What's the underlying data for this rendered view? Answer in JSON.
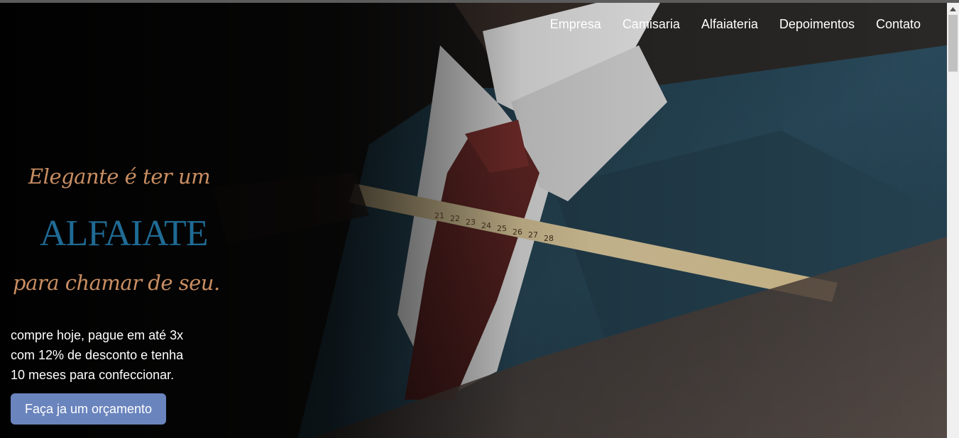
{
  "nav": {
    "items": [
      {
        "label": "Empresa"
      },
      {
        "label": "Camisaria"
      },
      {
        "label": "Alfaiateria"
      },
      {
        "label": "Depoimentos"
      },
      {
        "label": "Contato"
      }
    ]
  },
  "hero": {
    "tagline_top": "Elegante é ter um",
    "headline": "ALFAIATE",
    "tagline_bottom": "para chamar de seu.",
    "promo_lines": [
      "compre hoje, pague em até 3x",
      "com 12% de desconto e tenha",
      "10 meses para confeccionar."
    ],
    "cta_label": "Faça ja um orçamento",
    "tape_numbers": [
      "21",
      "22",
      "23",
      "24",
      "25",
      "26",
      "27",
      "28"
    ]
  },
  "colors": {
    "accent_script": "#c98e62",
    "headline_blue": "#1f6b95",
    "cta_background": "#6a84bd"
  },
  "icons": {
    "scroll_up": "chevron-up-icon"
  }
}
